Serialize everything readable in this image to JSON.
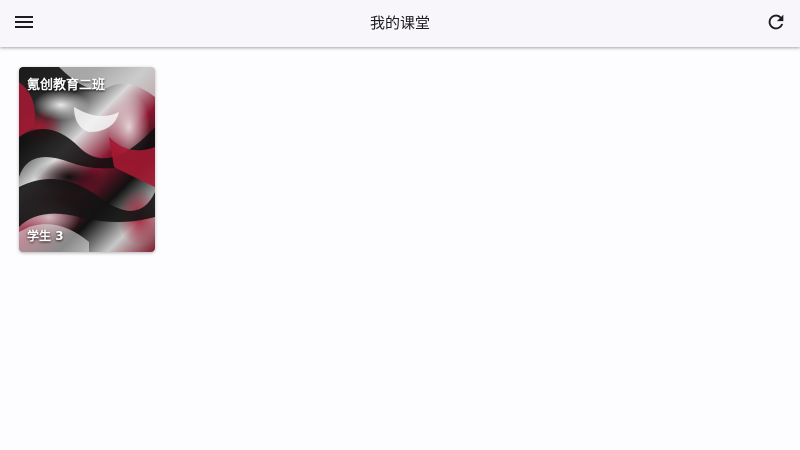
{
  "app_bar": {
    "title": "我的课堂",
    "menu_icon": "menu-icon",
    "refresh_icon": "refresh-icon"
  },
  "classes": [
    {
      "name": "氪创教育二班",
      "students_label": "学生",
      "students_count": "3"
    }
  ],
  "footer": {
    "text": ""
  },
  "colors": {
    "app_bar_bg": "#f8f6fa",
    "page_bg": "#fdfcfe",
    "icon_color": "#1d1b20",
    "card_accent": "#8a1530"
  }
}
